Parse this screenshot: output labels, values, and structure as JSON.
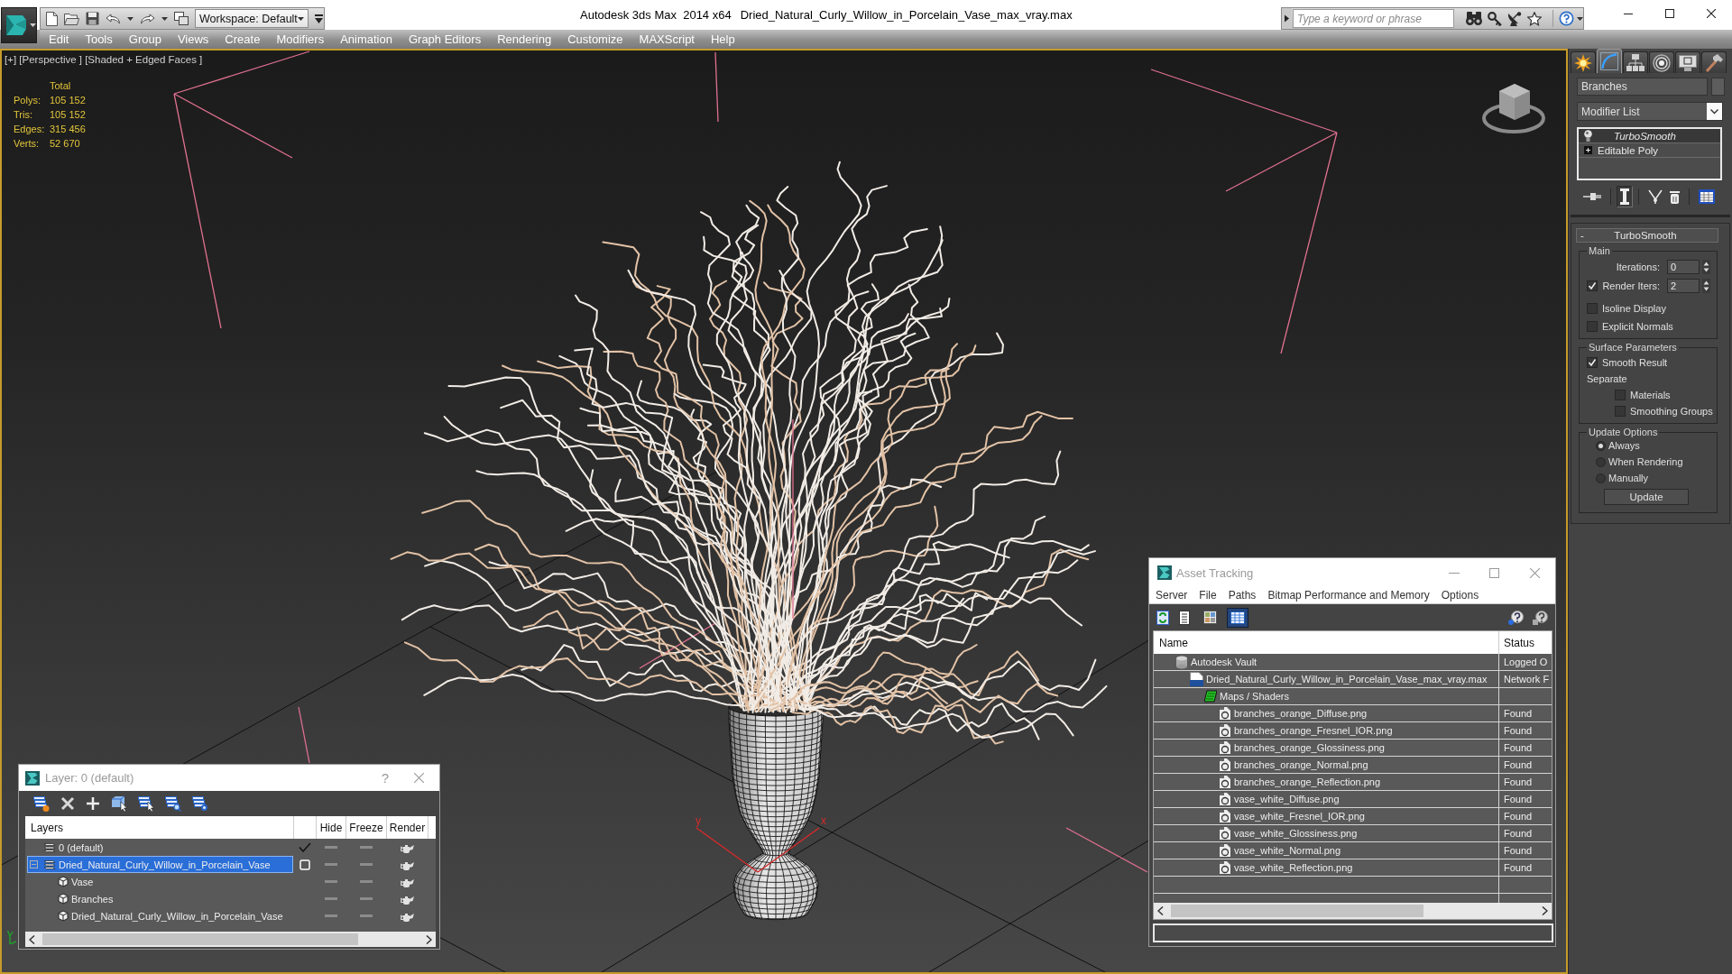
{
  "title_bar": {
    "workspace": "Workspace: Default",
    "app_name": "Autodesk 3ds Max  2014 x64",
    "file_name": "Dried_Natural_Curly_Willow_in_Porcelain_Vase_max_vray.max",
    "search": {
      "placeholder": "Type a keyword or phrase"
    }
  },
  "menu_bar": [
    "Edit",
    "Tools",
    "Group",
    "Views",
    "Create",
    "Modifiers",
    "Animation",
    "Graph Editors",
    "Rendering",
    "Customize",
    "MAXScript",
    "Help"
  ],
  "viewport": {
    "label": "[+] [Perspective ] [Shaded + Edged Faces ]",
    "active": true,
    "stats_heading": "Total",
    "stats": [
      {
        "label": "Polys:",
        "value": "105 152"
      },
      {
        "label": "Tris:",
        "value": "105 152"
      },
      {
        "label": "Edges:",
        "value": "315 456"
      },
      {
        "label": "Verts:",
        "value": "52 670"
      }
    ],
    "gizmo": {
      "axes": [
        {
          "label": "y"
        },
        {
          "label": "x"
        }
      ]
    }
  },
  "command_panel": {
    "tabs": [
      {
        "selected": false
      },
      {
        "selected": true
      },
      {
        "selected": false
      },
      {
        "selected": false
      },
      {
        "selected": false
      },
      {
        "selected": false
      }
    ],
    "object_name": "Branches",
    "modifier_list": "Modifier List",
    "stack": [
      {
        "kind": "modifier",
        "name": "TurboSmooth",
        "selected": true
      },
      {
        "kind": "object",
        "name": "Editable Poly",
        "selected": false
      }
    ],
    "stack_tools": [
      {
        "on": false
      },
      {
        "on": true
      },
      {
        "on": false
      },
      {
        "on": false
      },
      {
        "on": false
      }
    ],
    "rollout": {
      "title": "TurboSmooth",
      "collapse_sign": "-",
      "groups": [
        {
          "title": "Main",
          "controls": [
            {
              "kind": "spinner",
              "label": "Iterations:",
              "value": "0"
            },
            {
              "kind": "check_spinner",
              "label": "Render Iters:",
              "value": "2",
              "checked": true
            },
            {
              "kind": "checkbox",
              "label": "Isoline Display",
              "checked": false
            },
            {
              "kind": "checkbox",
              "label": "Explicit Normals",
              "checked": false
            }
          ]
        },
        {
          "title": "Surface Parameters",
          "controls": [
            {
              "kind": "checkbox",
              "label": "Smooth Result",
              "checked": true
            },
            {
              "kind": "label",
              "label": "Separate",
              "children": [
                {
                  "kind": "checkbox",
                  "label": "Materials",
                  "checked": false
                },
                {
                  "kind": "checkbox",
                  "label": "Smoothing Groups",
                  "checked": false
                }
              ]
            }
          ]
        },
        {
          "title": "Update Options",
          "controls": [
            {
              "kind": "radio",
              "label": "Always",
              "selected": true
            },
            {
              "kind": "radio",
              "label": "When Rendering",
              "selected": false
            },
            {
              "kind": "radio",
              "label": "Manually",
              "selected": false
            },
            {
              "kind": "button",
              "label": "Update"
            }
          ]
        }
      ]
    }
  },
  "asset_tracking": {
    "title": "Asset Tracking",
    "menu": [
      "Server",
      "File",
      "Paths",
      "Bitmap Performance and Memory",
      "Options"
    ],
    "view_modes": [
      {
        "selected": false
      },
      {
        "selected": false
      },
      {
        "selected": true
      }
    ],
    "columns": [
      "Name",
      "Status"
    ],
    "rows": [
      {
        "kind": "vault",
        "name": "Autodesk Vault",
        "status": "Logged O",
        "children": [
          {
            "kind": "scene_file",
            "name": "Dried_Natural_Curly_Willow_in_Porcelain_Vase_max_vray.max",
            "status": "Network F",
            "children": [
              {
                "kind": "folder",
                "name": "Maps / Shaders",
                "children": [
                  {
                    "kind": "image",
                    "name": "branches_orange_Diffuse.png",
                    "status": "Found"
                  },
                  {
                    "kind": "image",
                    "name": "branches_orange_Fresnel_IOR.png",
                    "status": "Found"
                  },
                  {
                    "kind": "image",
                    "name": "branches_orange_Glossiness.png",
                    "status": "Found"
                  },
                  {
                    "kind": "image",
                    "name": "branches_orange_Normal.png",
                    "status": "Found"
                  },
                  {
                    "kind": "image",
                    "name": "branches_orange_Reflection.png",
                    "status": "Found"
                  },
                  {
                    "kind": "image",
                    "name": "vase_white_Diffuse.png",
                    "status": "Found"
                  },
                  {
                    "kind": "image",
                    "name": "vase_white_Fresnel_IOR.png",
                    "status": "Found"
                  },
                  {
                    "kind": "image",
                    "name": "vase_white_Glossiness.png",
                    "status": "Found"
                  },
                  {
                    "kind": "image",
                    "name": "vase_white_Normal.png",
                    "status": "Found"
                  },
                  {
                    "kind": "image",
                    "name": "vase_white_Reflection.png",
                    "status": "Found"
                  }
                ]
              }
            ]
          }
        ]
      }
    ]
  },
  "layer_window": {
    "title": "Layer: 0 (default)",
    "help": "?",
    "columns": [
      "Layers",
      "Hide",
      "Freeze",
      "Render"
    ],
    "layers": [
      {
        "kind": "layer",
        "name": "0 (default)",
        "current": true,
        "selected": false,
        "hidden": false,
        "frozen": false,
        "renderable": true
      },
      {
        "kind": "layer",
        "name": "Dried_Natural_Curly_Willow_in_Porcelain_Vase",
        "current": false,
        "selected": true,
        "expanded": true,
        "hidden": false,
        "frozen": false,
        "renderable": true,
        "children": [
          {
            "kind": "object",
            "name": "Vase",
            "selected": false,
            "hidden": false,
            "frozen": false,
            "renderable": true
          },
          {
            "kind": "object",
            "name": "Branches",
            "selected": false,
            "hidden": false,
            "frozen": false,
            "renderable": true
          },
          {
            "kind": "object",
            "name": "Dried_Natural_Curly_Willow_in_Porcelain_Vase",
            "selected": false,
            "hidden": false,
            "frozen": false,
            "renderable": true
          }
        ]
      }
    ]
  }
}
